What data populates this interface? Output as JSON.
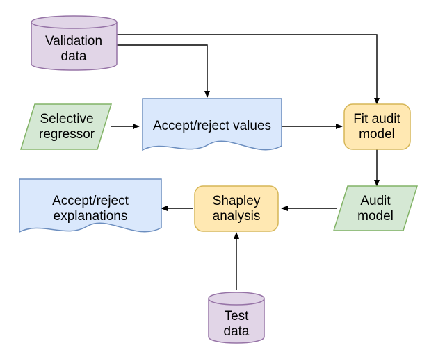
{
  "diagram": {
    "validation_data": {
      "line1": "Validation",
      "line2": "data"
    },
    "selective_regressor": {
      "line1": "Selective",
      "line2": "regressor"
    },
    "accept_reject_values": "Accept/reject values",
    "fit_audit_model": {
      "line1": "Fit audit",
      "line2": "model"
    },
    "audit_model": {
      "line1": "Audit",
      "line2": "model"
    },
    "shapley_analysis": {
      "line1": "Shapley",
      "line2": "analysis"
    },
    "accept_reject_explanations": {
      "line1": "Accept/reject",
      "line2": "explanations"
    },
    "test_data": {
      "line1": "Test",
      "line2": "data"
    }
  },
  "colors": {
    "purple_fill": "#e1d5e7",
    "purple_stroke": "#9673a6",
    "green_fill": "#d5e8d4",
    "green_stroke": "#82b366",
    "blue_fill": "#dae8fc",
    "blue_stroke": "#6c8ebf",
    "yellow_fill": "#ffe8b2",
    "yellow_stroke": "#d6b656",
    "arrow": "#000000"
  }
}
